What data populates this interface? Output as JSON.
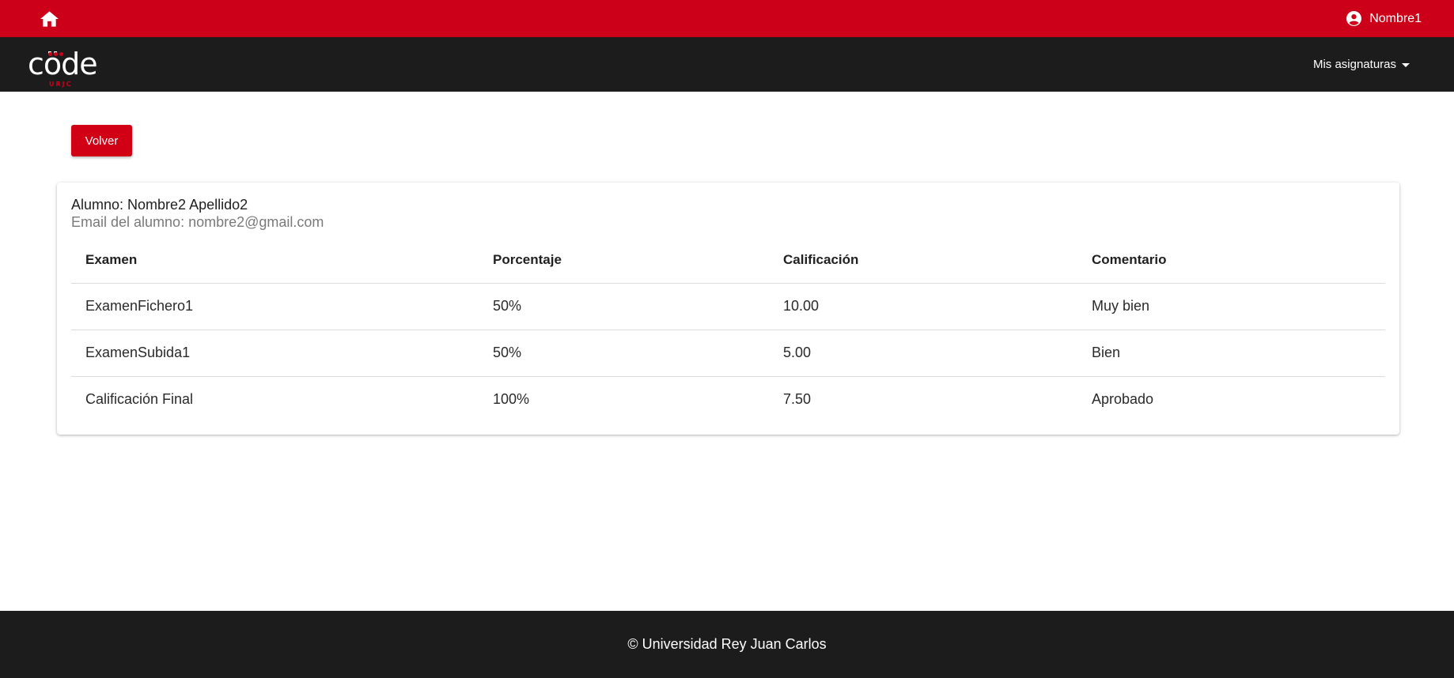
{
  "topbar": {
    "home_icon": "home-icon",
    "user_icon": "account-circle-icon",
    "user_name": "Nombre1"
  },
  "navbar": {
    "logo_text": "cöde",
    "logo_sub": "URJC",
    "menu_label": "Mis asignaturas"
  },
  "actions": {
    "back_label": "Volver"
  },
  "student": {
    "name_line": "Alumno: Nombre2 Apellido2",
    "email_line": "Email del alumno: nombre2@gmail.com"
  },
  "table": {
    "headers": [
      "Examen",
      "Porcentaje",
      "Calificación",
      "Comentario"
    ],
    "rows": [
      [
        "ExamenFichero1",
        "50%",
        "10.00",
        "Muy bien"
      ],
      [
        "ExamenSubida1",
        "50%",
        "5.00",
        "Bien"
      ],
      [
        "Calificación Final",
        "100%",
        "7.50",
        "Aprobado"
      ]
    ]
  },
  "footer": {
    "text": "© Universidad Rey Juan Carlos"
  },
  "colors": {
    "primary_red": "#cc0018",
    "dark_bar": "#1c1c1c"
  }
}
